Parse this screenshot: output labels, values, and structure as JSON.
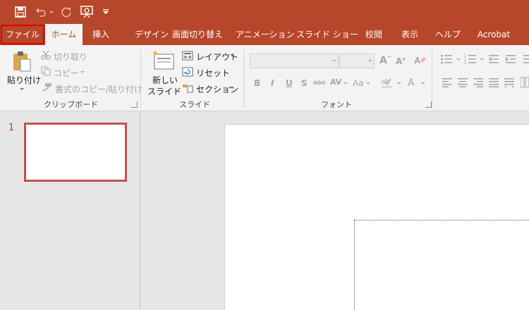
{
  "titlebar": {
    "quick_access": [
      "save-icon",
      "undo-icon",
      "redo-icon",
      "present-from-start-icon",
      "customize-qat-icon"
    ]
  },
  "tabs": [
    {
      "label": "ファイル",
      "active": false
    },
    {
      "label": "ホーム",
      "active": true
    },
    {
      "label": "挿入",
      "active": false
    },
    {
      "label": "デザイン",
      "active": false
    },
    {
      "label": "画面切り替え",
      "active": false
    },
    {
      "label": "アニメーション",
      "active": false
    },
    {
      "label": "スライド ショー",
      "active": false
    },
    {
      "label": "校閲",
      "active": false
    },
    {
      "label": "表示",
      "active": false
    },
    {
      "label": "ヘルプ",
      "active": false
    },
    {
      "label": "Acrobat",
      "active": false
    }
  ],
  "ribbon": {
    "clipboard": {
      "group_label": "クリップボード",
      "paste_label": "貼り付け",
      "cut_label": "切り取り",
      "copy_label": "コピー",
      "format_painter_label": "書式のコピー/貼り付け"
    },
    "slides": {
      "group_label": "スライド",
      "new_slide_line1": "新しい",
      "new_slide_line2": "スライド",
      "layout_label": "レイアウト",
      "reset_label": "リセット",
      "section_label": "セクション"
    },
    "font": {
      "group_label": "フォント",
      "font_name": "",
      "font_size": "",
      "bold": "B",
      "italic": "I",
      "underline": "U",
      "shadow": "S",
      "strike": "abc",
      "spacing": "AV",
      "case": "Aa",
      "color": "A"
    }
  },
  "slides_pane": {
    "items": [
      {
        "number": "1"
      }
    ]
  },
  "colors": {
    "accent": "#b7472a",
    "ribbon_bg": "#f3f3f3",
    "file_highlight": "#e30000",
    "thumb_border": "#c0504d"
  }
}
